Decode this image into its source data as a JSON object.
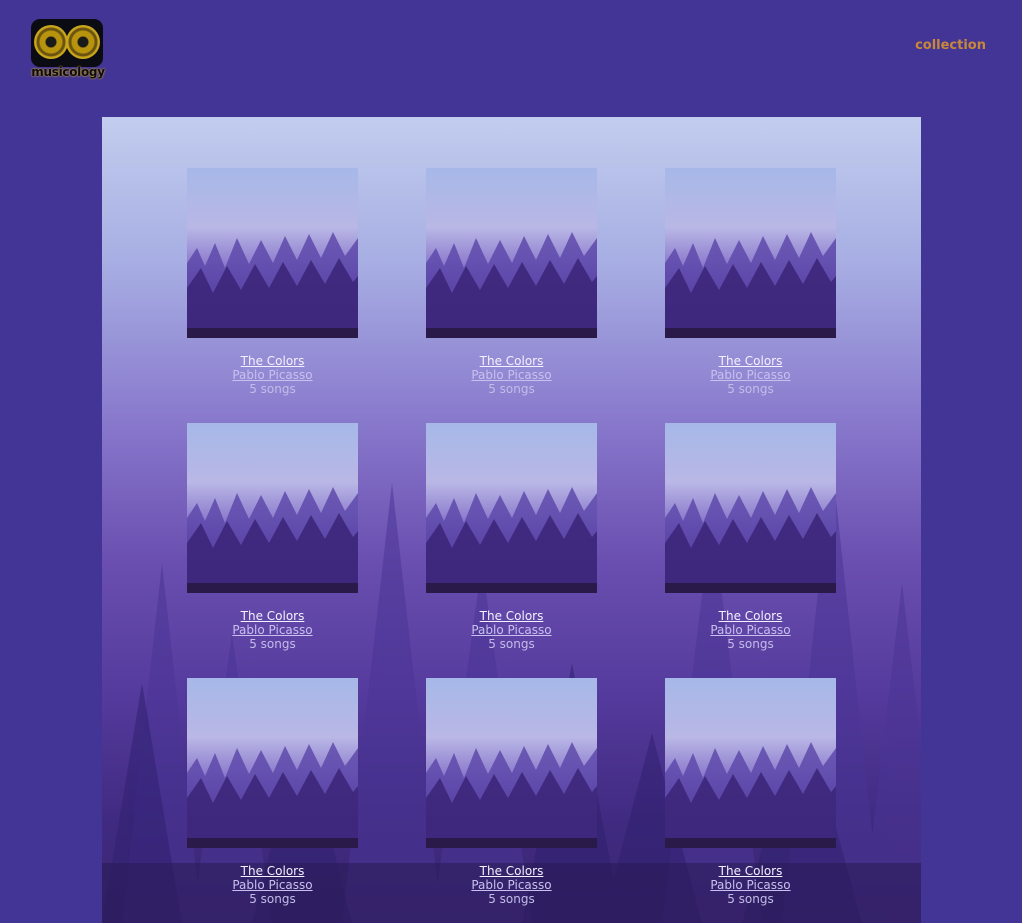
{
  "brand": {
    "logo_text": "musicology",
    "accent": "#c9a51c"
  },
  "nav": {
    "collection_label": "collection",
    "color": "#c9873a"
  },
  "theme": {
    "page_bg": "#433596",
    "panel_top": "#c2cdee",
    "panel_bottom": "#3a2670"
  },
  "albums": [
    {
      "title": "The Colors",
      "artist": "Pablo Picasso",
      "songs": "5 songs"
    },
    {
      "title": "The Colors",
      "artist": "Pablo Picasso",
      "songs": "5 songs"
    },
    {
      "title": "The Colors",
      "artist": "Pablo Picasso",
      "songs": "5 songs"
    },
    {
      "title": "The Colors",
      "artist": "Pablo Picasso",
      "songs": "5 songs"
    },
    {
      "title": "The Colors",
      "artist": "Pablo Picasso",
      "songs": "5 songs"
    },
    {
      "title": "The Colors",
      "artist": "Pablo Picasso",
      "songs": "5 songs"
    },
    {
      "title": "The Colors",
      "artist": "Pablo Picasso",
      "songs": "5 songs"
    },
    {
      "title": "The Colors",
      "artist": "Pablo Picasso",
      "songs": "5 songs"
    },
    {
      "title": "The Colors",
      "artist": "Pablo Picasso",
      "songs": "5 songs"
    }
  ]
}
